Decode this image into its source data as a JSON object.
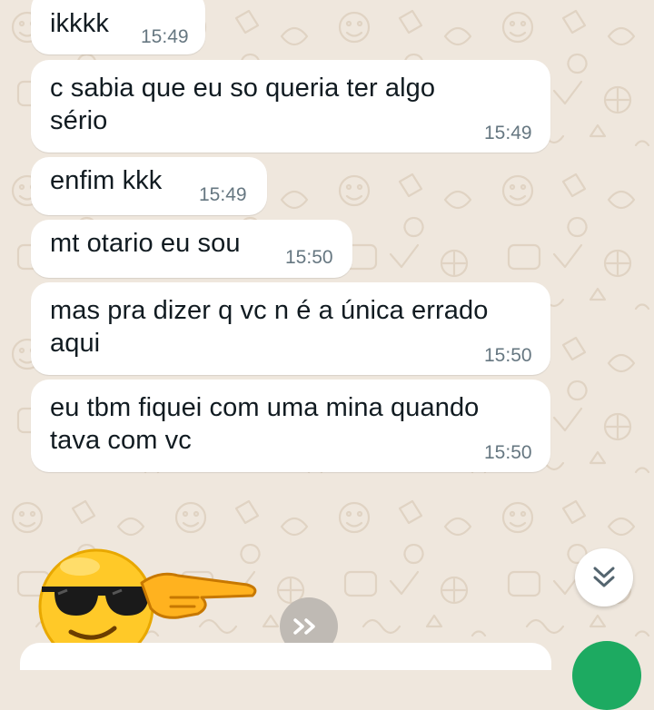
{
  "messages": [
    {
      "text": "ikkkk",
      "time": "15:49"
    },
    {
      "lines": [
        "c sabia que eu so queria ter algo",
        "sério"
      ],
      "time": "15:49"
    },
    {
      "text": "enfim kkk",
      "time": "15:49"
    },
    {
      "text": "mt otario eu sou",
      "time": "15:50"
    },
    {
      "lines": [
        "mas pra dizer q vc n é a única errado",
        "aqui"
      ],
      "time": "15:50"
    },
    {
      "lines": [
        "eu tbm fiquei com uma mina quando",
        "tava com vc"
      ],
      "time": "15:50"
    }
  ],
  "sticker": {
    "description": "cool-sunglasses-emoji-pointing-sticker"
  },
  "icons": {
    "scroll_down": "double-chevron-down-icon",
    "forward": "forward-icon"
  },
  "colors": {
    "wallpaper": "#efe7dd",
    "bubble": "#ffffff",
    "timestamp": "#667781",
    "accent": "#1daa61"
  }
}
